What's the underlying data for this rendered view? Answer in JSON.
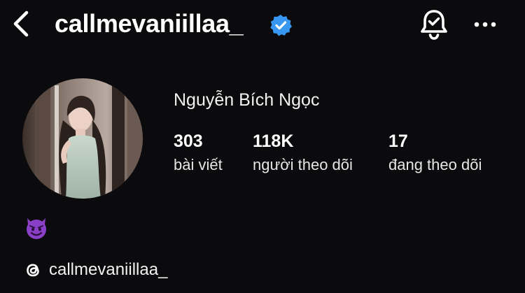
{
  "header": {
    "username": "callmevaniillaa_",
    "verified": true,
    "icons": [
      "back-icon",
      "verified-badge-icon",
      "notification-bell-icon",
      "more-options-icon"
    ]
  },
  "profile": {
    "full_name": "Nguyễn Bích Ngọc",
    "stats": {
      "posts": {
        "value": "303",
        "label": "bài viết"
      },
      "followers": {
        "value": "118K",
        "label": "người theo dõi"
      },
      "following": {
        "value": "17",
        "label": "đang theo dõi"
      }
    },
    "bio_emoji": "smiling-face-with-horns",
    "threads_handle": "callmevaniillaa_"
  },
  "colors": {
    "background": "#0b0b0d",
    "text": "#f5f5f5",
    "verified_badge": "#3897f0",
    "emoji_purple": "#8a3fc7"
  }
}
